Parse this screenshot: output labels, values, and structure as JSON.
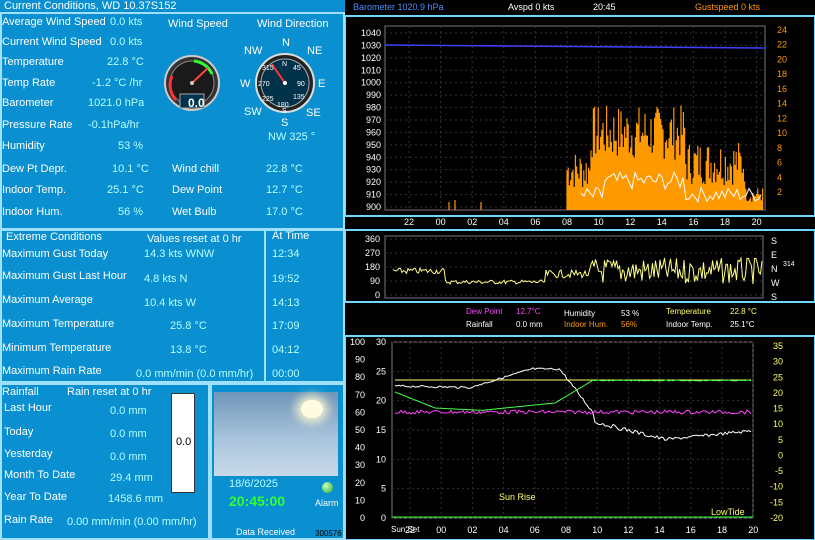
{
  "window_title": "Current Conditions, WD 10.37S152",
  "current": {
    "avg_wind_label": "Average Wind Speed",
    "avg_wind_value": "0.0 kts",
    "cur_wind_label": "Current Wind Speed",
    "cur_wind_value": "0.0 kts",
    "temp_label": "Temperature",
    "temp_value": "22.8 °C",
    "temp_rate_label": "Temp Rate",
    "temp_rate_value": "-1.2 °C /hr",
    "baro_label": "Barometer",
    "baro_value": "1021.0 hPa",
    "press_rate_label": "Pressure  Rate",
    "press_rate_value": "-0.1hPa/hr",
    "humidity_label": "Humidity",
    "humidity_value": "53 %",
    "dewpt_depr_label": "Dew Pt Depr.",
    "dewpt_depr_value": "10.1 °C",
    "indoor_temp_label": "Indoor Temp.",
    "indoor_temp_value": "25.1 °C",
    "indoor_hum_label": "Indoor Hum.",
    "indoor_hum_value": "56 %",
    "windchill_label": "Wind chill",
    "windchill_value": "22.8 °C",
    "dewpoint_label": "Dew Point",
    "dewpoint_value": "12.7 °C",
    "wetbulb_label": "Wet Bulb",
    "wetbulb_value": "17.0 °C"
  },
  "gauges": {
    "wind_speed_title": "Wind Speed",
    "wind_speed_reading": "0.0",
    "wind_dir_title": "Wind Direction",
    "compass": {
      "n": "N",
      "ne": "NE",
      "e": "E",
      "se": "SE",
      "s": "S",
      "sw": "SW",
      "w": "W",
      "nw": "NW"
    },
    "dial_n": "N",
    "dial_s": "S",
    "dial_ticks": {
      "t45": "45",
      "t90": "90",
      "t135": "135",
      "t180": "180",
      "t225": "225",
      "t270": "270",
      "t315": "315"
    },
    "wind_dir_reading": "NW  325 °",
    "wind_dir_degrees": 325
  },
  "extremes": {
    "title": "Extreme Conditions",
    "reset_note": "Values reset at 0 hr",
    "at_time_header": "At Time",
    "rows": [
      {
        "label": "Maximum Gust Today",
        "value": "14.3 kts  WNW",
        "time": "12:34"
      },
      {
        "label": "Maximum Gust Last Hour",
        "value": "4.8 kts   N",
        "time": "19:52"
      },
      {
        "label": "Maximum Average",
        "value": "10.4 kts   W",
        "time": "14:13"
      },
      {
        "label": "Maximum Temperature",
        "value": "25.8 °C",
        "time": "17:09"
      },
      {
        "label": "Minimum Temperature",
        "value": "13.8 °C",
        "time": "04:12"
      },
      {
        "label": "Maximum      Rain Rate",
        "value": "0.0 mm/min (0.0 mm/hr)",
        "time": "00:00"
      }
    ]
  },
  "rain": {
    "title": "Rainfall",
    "reset_note": "Rain reset at 0 hr",
    "last_hour_label": "Last Hour",
    "last_hour_value": "0.0 mm",
    "today_label": "Today",
    "today_value": "0.0 mm",
    "yesterday_label": "Yesterday",
    "yesterday_value": "0.0 mm",
    "month_label": "Month To Date",
    "month_value": "29.4 mm",
    "year_label": "Year To Date",
    "year_value": "1458.6 mm",
    "rate_label": "Rain Rate",
    "rate_value": "0.00 mm/min (0.00 mm/hr)",
    "gauge_value": "0.0"
  },
  "status": {
    "date": "18/6/2025",
    "time": "20:45:00",
    "alarm_label": "Alarm",
    "data_received_label": "Data Received",
    "data_received_count": "300576"
  },
  "graph1": {
    "barometer_header": "Barometer  1020.9 hPa",
    "avspd_header": "Avspd  0 kts",
    "time_header": "20:45",
    "gust_header": "Gustspeed  0 kts",
    "left_ticks": [
      "1040",
      "1030",
      "1020",
      "1010",
      "1000",
      "990",
      "980",
      "970",
      "960",
      "950",
      "940",
      "930",
      "920",
      "910",
      "900"
    ],
    "right_ticks": [
      "24",
      "22",
      "20",
      "18",
      "16",
      "14",
      "12",
      "10",
      "8",
      "6",
      "4",
      "2"
    ],
    "x_ticks": [
      "22",
      "00",
      "02",
      "04",
      "06",
      "08",
      "10",
      "12",
      "14",
      "16",
      "18",
      "20"
    ],
    "colors": {
      "barometer": "#4040ff",
      "gust": "#ff9900",
      "avg": "#ffffff"
    }
  },
  "graph2": {
    "left_ticks": [
      "360",
      "270",
      "180",
      "90",
      "0"
    ],
    "right_labels": [
      "S",
      "E",
      "N",
      "W",
      "S"
    ],
    "last_value": "314",
    "colors": {
      "direction": "#ffff88"
    }
  },
  "legend": {
    "dewpoint_label": "Dew Point",
    "dewpoint_value": "12.7°C",
    "humidity_label": "Humidity",
    "humidity_value": "53 %",
    "temperature_label": "Temperature",
    "temperature_value": "22.8 °C",
    "rainfall_label": "Rainfall",
    "rainfall_value": "0.0 mm",
    "indoor_hum_label": "Indoor Hum.",
    "indoor_hum_value": "56%",
    "indoor_temp_label": "Indoor Temp.",
    "indoor_temp_value": "25.1°C",
    "colors": {
      "dewpoint": "#ff44ff",
      "humidity": "#ffffff",
      "temperature": "#ffff66",
      "rainfall": "#ffffff",
      "indoor_hum": "#ff9900",
      "indoor_temp": "#ffffff"
    }
  },
  "graph3": {
    "far_left_ticks": [
      "100",
      "90",
      "80",
      "70",
      "60",
      "50",
      "40",
      "30",
      "20",
      "10",
      "0"
    ],
    "left_ticks": [
      "30",
      "25",
      "20",
      "15",
      "10",
      "5",
      "0"
    ],
    "right_ticks": [
      "35",
      "30",
      "25",
      "20",
      "15",
      "10",
      "5",
      "0",
      "-5",
      "-10",
      "-15",
      "-20"
    ],
    "x_ticks": [
      "22",
      "00",
      "02",
      "04",
      "06",
      "08",
      "10",
      "12",
      "14",
      "16",
      "18",
      "20"
    ],
    "sunset_label": "Sun Set",
    "sunrise_label": "Sun Rise",
    "lowtide_label": "LowTide",
    "colors": {
      "temperature": "#ffff66",
      "humidity": "#ffffff",
      "dewpoint": "#ff44ff",
      "indoor": "#44ff44"
    }
  }
}
